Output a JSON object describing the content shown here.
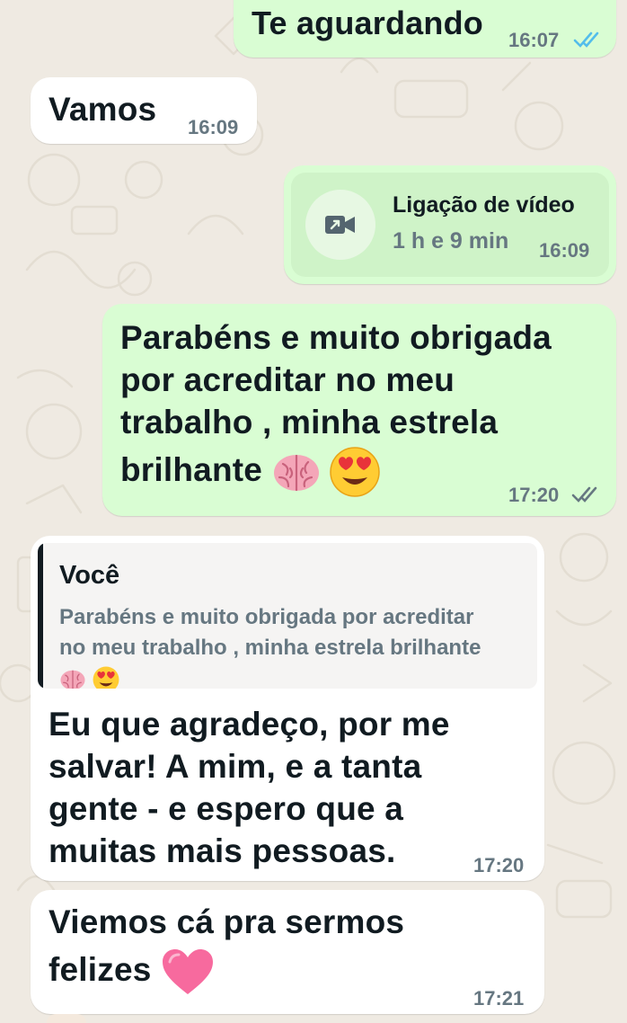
{
  "messages": [
    {
      "direction": "outgoing",
      "text": "Te aguardando",
      "time": "16:07",
      "status": "read"
    },
    {
      "direction": "incoming",
      "text": "Vamos",
      "time": "16:09"
    },
    {
      "direction": "outgoing",
      "type": "video-call",
      "call_title": "Ligação de vídeo",
      "call_duration": "1 h e 9 min",
      "time": "16:09"
    },
    {
      "direction": "outgoing",
      "text_lines": [
        "Parabéns e muito obrigada",
        "por acreditar no meu",
        "trabalho , minha estrela",
        "brilhante"
      ],
      "emojis": [
        "brain-emoji",
        "heart-eyes-emoji"
      ],
      "time": "17:20",
      "status": "delivered"
    },
    {
      "direction": "incoming",
      "reply_to": {
        "author": "Você",
        "text_lines": [
          "Parabéns e muito obrigada por acreditar",
          "no meu trabalho , minha estrela brilhante"
        ],
        "emojis": [
          "brain-emoji",
          "heart-eyes-emoji"
        ]
      },
      "text_lines": [
        "Eu que agradeço, por me",
        "salvar! A mim, e a tanta",
        "gente - e espero que a",
        "muitas mais pessoas."
      ],
      "time": "17:20"
    },
    {
      "direction": "incoming",
      "text_lines": [
        "Viemos cá pra sermos",
        "felizes"
      ],
      "emojis": [
        "pink-heart-emoji"
      ],
      "time": "17:21"
    }
  ],
  "colors": {
    "outgoing_bubble": "#d9fdd3",
    "incoming_bubble": "#ffffff",
    "background": "#efeae2",
    "read_ticks": "#53bdeb",
    "delivered_ticks": "#667781"
  }
}
